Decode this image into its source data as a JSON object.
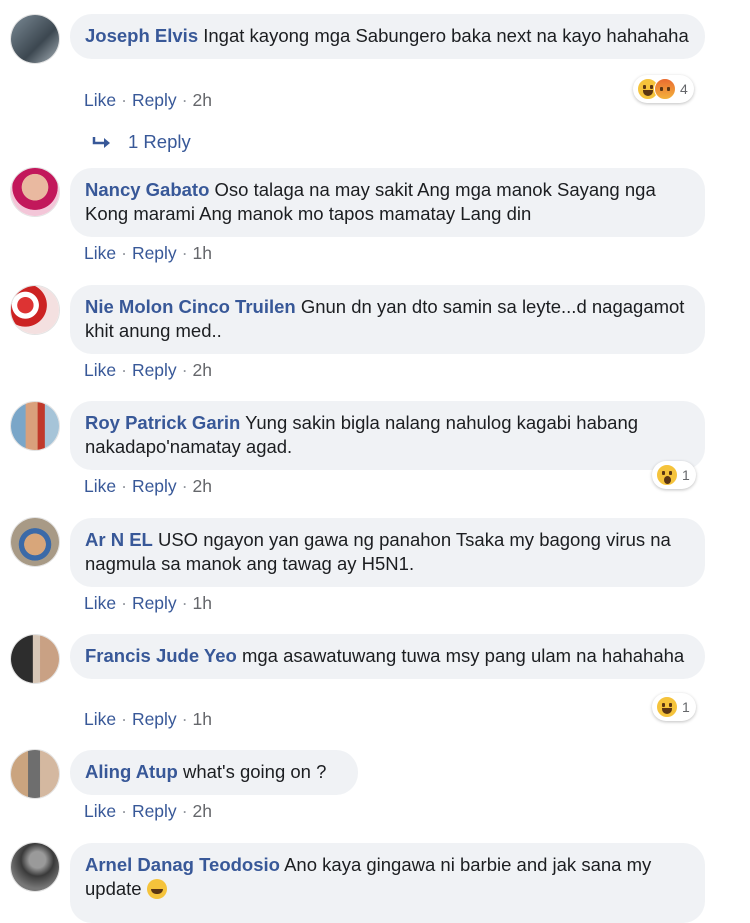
{
  "comments": [
    {
      "author": "Joseph Elvis",
      "text": "Ingat kayong mga Sabungero baka next na kayo hahahaha",
      "actions": {
        "like": "Like",
        "reply": "Reply",
        "time": "2h"
      },
      "reactions": {
        "types": [
          "haha",
          "angry"
        ],
        "count": "4"
      }
    },
    {
      "author": "Nancy Gabato",
      "text": "Oso talaga na may sakit Ang mga manok Sayang nga Kong marami Ang manok mo tapos mamatay Lang din",
      "actions": {
        "like": "Like",
        "reply": "Reply",
        "time": "1h"
      }
    },
    {
      "author": "Nie Molon Cinco Truilen",
      "text": "Gnun dn yan dto samin sa leyte...d nagagamot khit anung med..",
      "actions": {
        "like": "Like",
        "reply": "Reply",
        "time": "2h"
      }
    },
    {
      "author": "Roy Patrick Garin",
      "text": "Yung sakin bigla nalang nahulog kagabi habang nakadapo'namatay agad.",
      "actions": {
        "like": "Like",
        "reply": "Reply",
        "time": "2h"
      },
      "reactions": {
        "types": [
          "wow"
        ],
        "count": "1"
      }
    },
    {
      "author": "Ar N EL",
      "text": "USO ngayon yan gawa ng panahon Tsaka my bagong virus na nagmula sa manok ang tawag ay H5N1.",
      "actions": {
        "like": "Like",
        "reply": "Reply",
        "time": "1h"
      }
    },
    {
      "author": "Francis Jude Yeo",
      "text": "mga asawatuwang tuwa msy pang ulam na hahahaha",
      "actions": {
        "like": "Like",
        "reply": "Reply",
        "time": "1h"
      },
      "reactions": {
        "types": [
          "haha"
        ],
        "count": "1"
      }
    },
    {
      "author": "Aling Atup",
      "text": "what's going on ?",
      "actions": {
        "like": "Like",
        "reply": "Reply",
        "time": "2h"
      }
    },
    {
      "author": "Arnel Danag Teodosio",
      "text": "Ano kaya gingawa ni barbie and jak sana my update"
    }
  ],
  "replies_link": {
    "label": "1 Reply"
  },
  "colors": {
    "link": "#385898",
    "bubble": "#f0f2f5",
    "meta": "#65676b",
    "text": "#1c1e21"
  }
}
